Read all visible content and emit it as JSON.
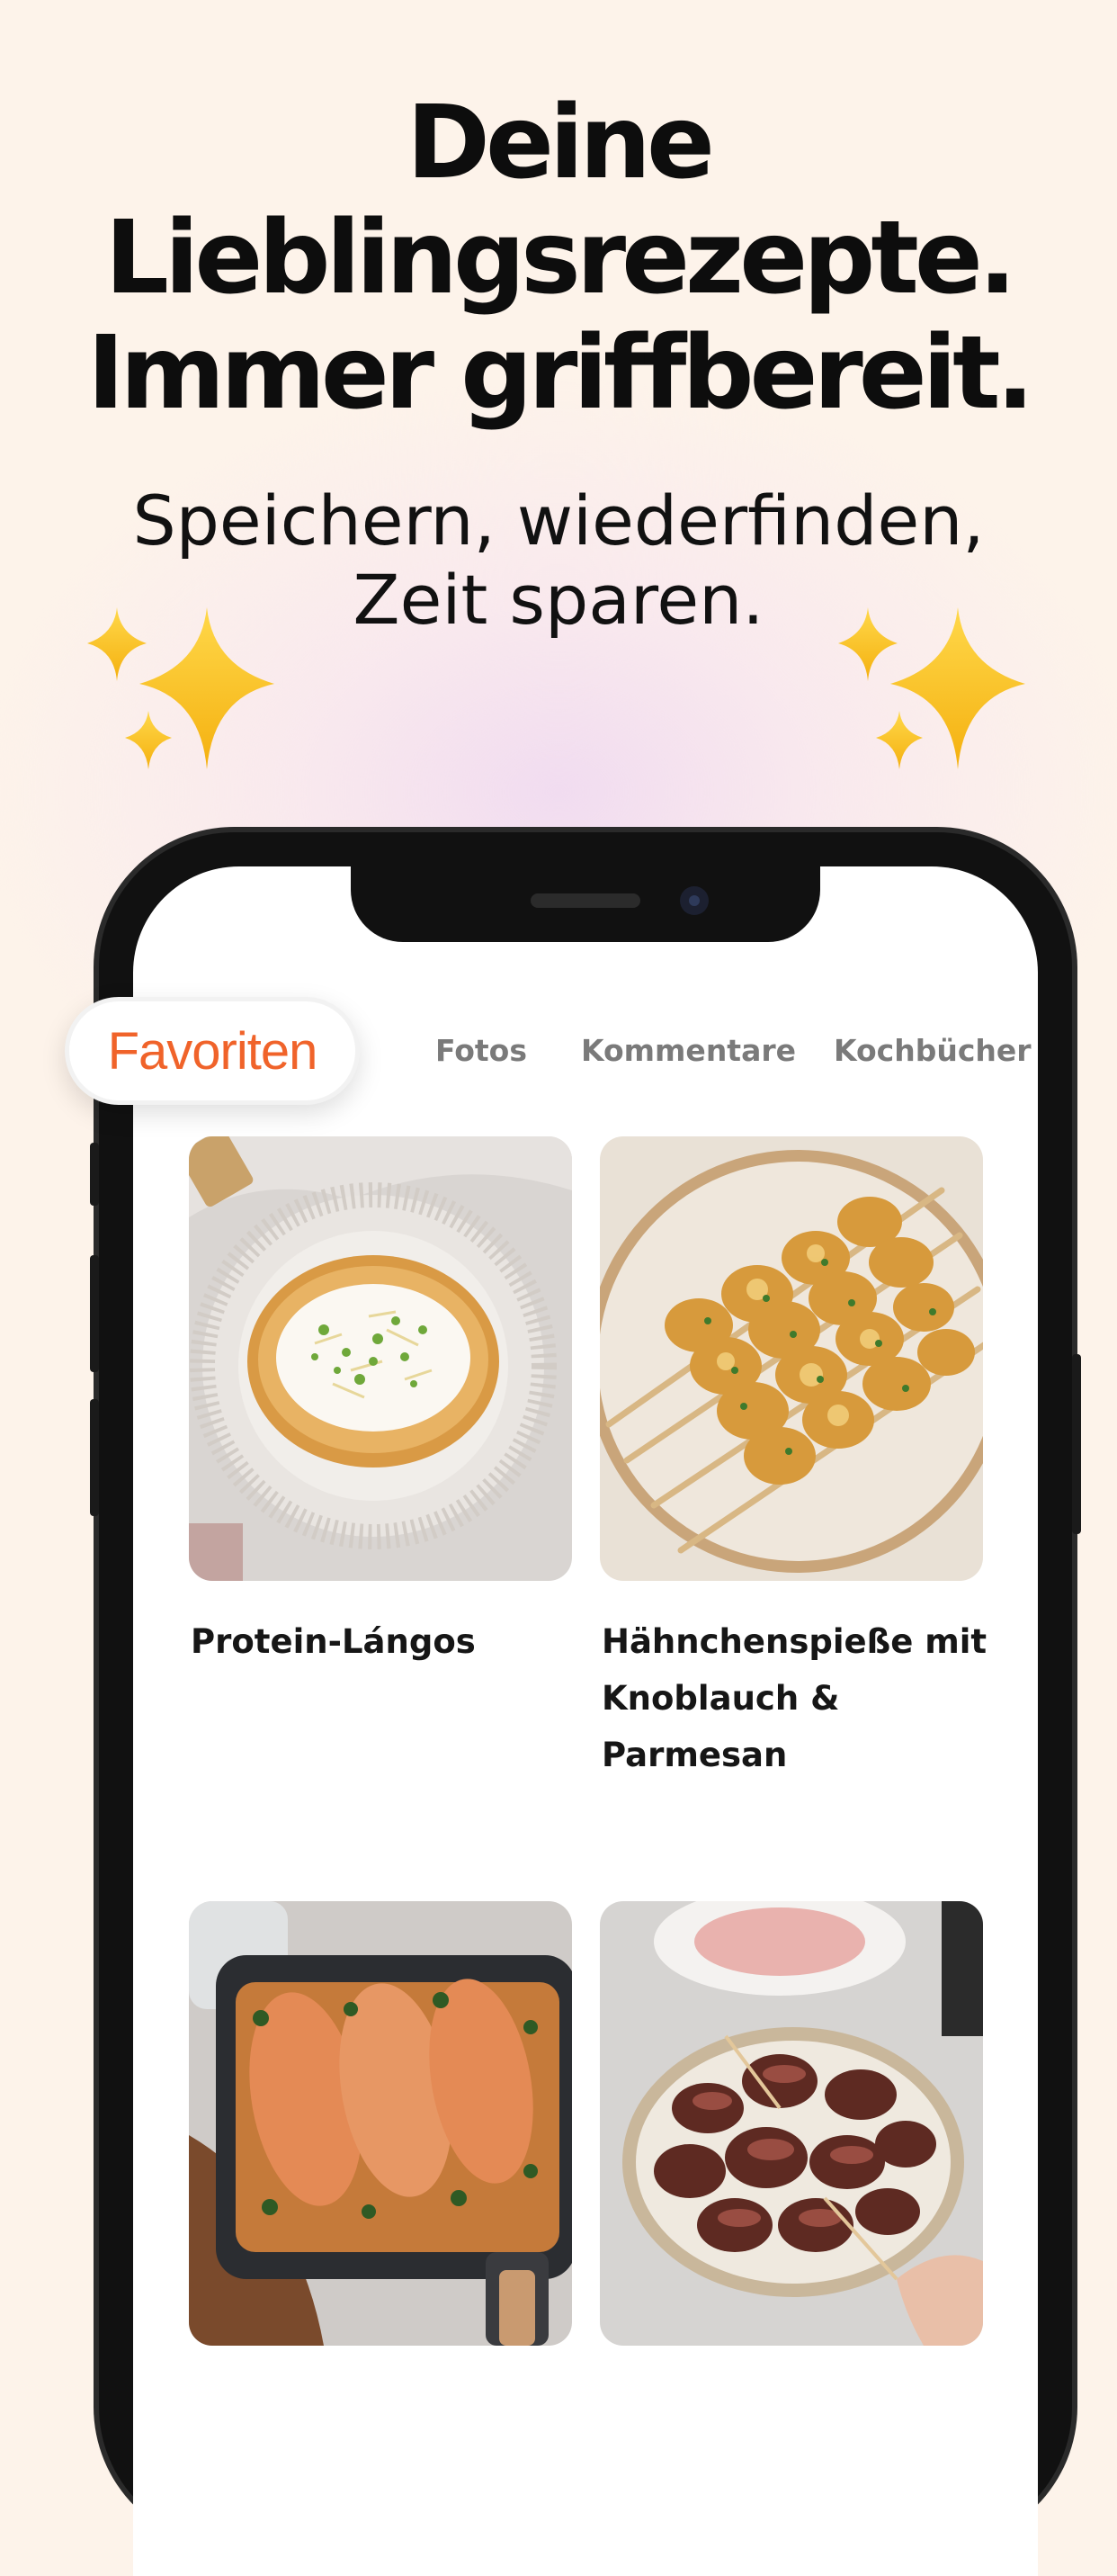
{
  "headline": {
    "line1": "Deine",
    "line2": "Lieblingsrezepte.",
    "line3": "Immer griffbereit."
  },
  "subline": {
    "line1": "Speichern, wiederfinden,",
    "line2": "Zeit sparen."
  },
  "decorations": {
    "icon": "sparkles-icon",
    "color": "#f8c21c"
  },
  "tabs": [
    {
      "label": "Favoriten",
      "active": true
    },
    {
      "label": "Fotos",
      "active": false
    },
    {
      "label": "Kommentare",
      "active": false
    },
    {
      "label": "Kochbücher",
      "active": false
    }
  ],
  "accent_color": "#f0632a",
  "recipes": [
    {
      "title": "Protein-Lángos",
      "image": "langos-photo"
    },
    {
      "title": "Hähnchenspieße mit Knoblauch & Parmesan",
      "image": "chicken-skewers-photo"
    },
    {
      "title": "",
      "image": "salmon-airfryer-photo"
    },
    {
      "title": "",
      "image": "bacon-dates-photo"
    }
  ]
}
